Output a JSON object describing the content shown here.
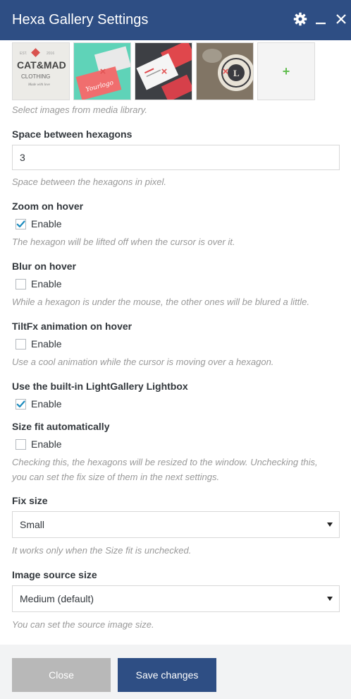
{
  "window": {
    "title": "Hexa Gallery Settings",
    "icons": [
      "gear-icon",
      "minimize-icon",
      "close-icon"
    ]
  },
  "images": {
    "thumbnails": [
      {
        "name": "clothing-logo-thumbnail",
        "text": "CAT & MAD CLOTHING"
      },
      {
        "name": "business-card-thumbnail",
        "text": "Yourlogo"
      },
      {
        "name": "red-card-thumbnail",
        "text": ""
      },
      {
        "name": "leather-badge-thumbnail",
        "text": ""
      }
    ],
    "add_icon": "plus-icon",
    "remove_icon": "remove-x-icon",
    "help": "Select images from media library."
  },
  "space": {
    "label": "Space between hexagons",
    "value": "3",
    "help": "Space between the hexagons in pixel."
  },
  "zoom": {
    "label": "Zoom on hover",
    "option": "Enable",
    "checked": true,
    "help": "The hexagon will be lifted off when the cursor is over it."
  },
  "blur": {
    "label": "Blur on hover",
    "option": "Enable",
    "checked": false,
    "help": "While a hexagon is under the mouse, the other ones will be blured a little."
  },
  "tiltfx": {
    "label": "TiltFx animation on hover",
    "option": "Enable",
    "checked": false,
    "help": "Use a cool animation while the cursor is moving over a hexagon."
  },
  "lightbox": {
    "label": "Use the built-in LightGallery Lightbox",
    "option": "Enable",
    "checked": true
  },
  "sizefit": {
    "label": "Size fit automatically",
    "option": "Enable",
    "checked": false,
    "help_line1": "Checking this, the hexagons will be resized to the window. Unchecking this,",
    "help_line2": "you can set the fix size of them in the next settings."
  },
  "fixsize": {
    "label": "Fix size",
    "selected": "Small",
    "help": "It works only when the Size fit is unchecked."
  },
  "imagesource": {
    "label": "Image source size",
    "selected": "Medium (default)",
    "help": "You can set the source image size."
  },
  "footer": {
    "close_label": "Close",
    "save_label": "Save changes"
  },
  "colors": {
    "titlebar": "#2e4e84",
    "save_button": "#2e4e84",
    "close_button": "#b8b8b8",
    "checkmark": "#1e8cbe",
    "add_plus": "#61bd4f",
    "remove_x": "#e25555"
  }
}
